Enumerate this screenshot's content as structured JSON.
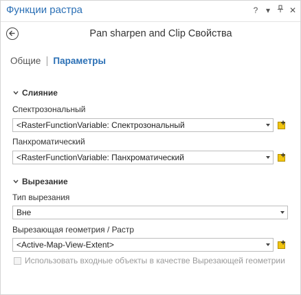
{
  "window": {
    "title": "Функции растра",
    "controls": {
      "help": "?",
      "menu": "▾",
      "pin": "⊥",
      "close": "✕"
    }
  },
  "header": {
    "title": "Pan sharpen and Clip  Свойства"
  },
  "tabs": {
    "general": "Общие",
    "parameters": "Параметры"
  },
  "merge_section": {
    "title": "Слияние",
    "multispectral_label": "Спектрозональный",
    "multispectral_value": "<RasterFunctionVariable: Спектрозональный",
    "panchromatic_label": "Панхроматический",
    "panchromatic_value": "<RasterFunctionVariable: Панхроматический"
  },
  "clip_section": {
    "title": "Вырезание",
    "clip_type_label": "Тип вырезания",
    "clip_type_value": "Вне",
    "clip_geometry_label": "Вырезающая геометрия / Растр",
    "clip_geometry_value": "<Active-Map-View-Extent>",
    "use_input_features_label": "Использовать входные объекты в качестве Вырезающей геометрии",
    "use_input_features_checked": false
  },
  "colors": {
    "accent": "#2a6fb5",
    "add_icon": "#e0b400"
  }
}
